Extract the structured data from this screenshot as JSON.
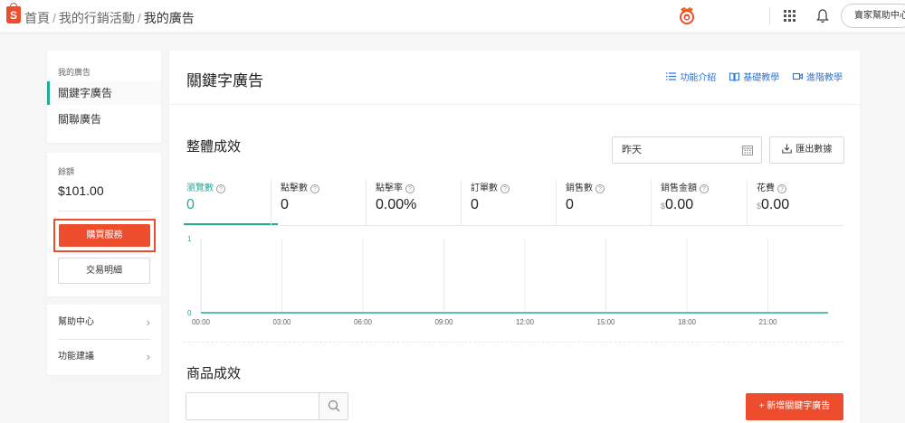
{
  "header": {
    "logo_letter": "S",
    "breadcrumbs": [
      "首頁",
      "我的行銷活動",
      "我的廣告"
    ],
    "separator": "/",
    "help_label": "賣家幫助中心"
  },
  "sidebar": {
    "ads_title": "我的廣告",
    "ads_items": [
      "關鍵字廣告",
      "關聯廣告"
    ],
    "balance_label": "餘額",
    "balance_value": "$101.00",
    "buy_label": "購買服務",
    "transactions_label": "交易明細",
    "links": [
      "幫助中心",
      "功能建議"
    ],
    "chevron": "›"
  },
  "main": {
    "title": "關鍵字廣告",
    "toplinks": [
      "功能介紹",
      "基礎教學",
      "進階教學"
    ],
    "overall_title": "整體成效",
    "date_value": "昨天",
    "export_label": "匯出數據",
    "metrics": [
      {
        "label": "瀏覽數",
        "value": "0",
        "prefix": ""
      },
      {
        "label": "點擊數",
        "value": "0",
        "prefix": ""
      },
      {
        "label": "點擊率",
        "value": "0.00%",
        "prefix": ""
      },
      {
        "label": "訂單數",
        "value": "0",
        "prefix": ""
      },
      {
        "label": "銷售數",
        "value": "0",
        "prefix": ""
      },
      {
        "label": "銷售金額",
        "value": "0.00",
        "prefix": "$"
      },
      {
        "label": "花費",
        "value": "0.00",
        "prefix": "$"
      }
    ],
    "help_mark": "?",
    "product_title": "商品成效",
    "search_placeholder": "",
    "add_keyword_label": "+ 新增關鍵字廣告"
  },
  "colors": {
    "brand": "#ee4d2d",
    "accent": "#26aa99",
    "link": "#2673dd"
  },
  "chart_data": {
    "type": "line",
    "x": [
      "00:00",
      "03:00",
      "06:00",
      "09:00",
      "12:00",
      "15:00",
      "18:00",
      "21:00"
    ],
    "series": [
      {
        "values": [
          0,
          0,
          0,
          0,
          0,
          0,
          0,
          0
        ]
      }
    ],
    "ylim": [
      0,
      1
    ],
    "yticks": [
      "0",
      "1"
    ],
    "grid": "vertical"
  }
}
